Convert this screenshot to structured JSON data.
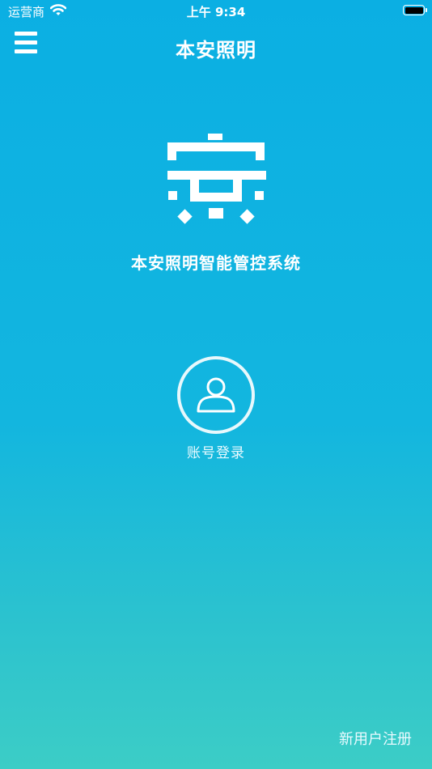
{
  "status_bar": {
    "carrier": "运营商",
    "time": "上午 9:34"
  },
  "nav": {
    "title": "本安照明",
    "menu_icon": "hamburger-menu-icon"
  },
  "brand": {
    "logo_icon": "benan-logo-icon",
    "system_title": "本安照明智能管控系统"
  },
  "login": {
    "icon": "user-icon",
    "label": "账号登录"
  },
  "footer": {
    "register_label": "新用户注册"
  },
  "colors": {
    "gradient_top": "#0bafe3",
    "gradient_bottom": "#3ccdc6",
    "foreground": "#ffffff"
  }
}
